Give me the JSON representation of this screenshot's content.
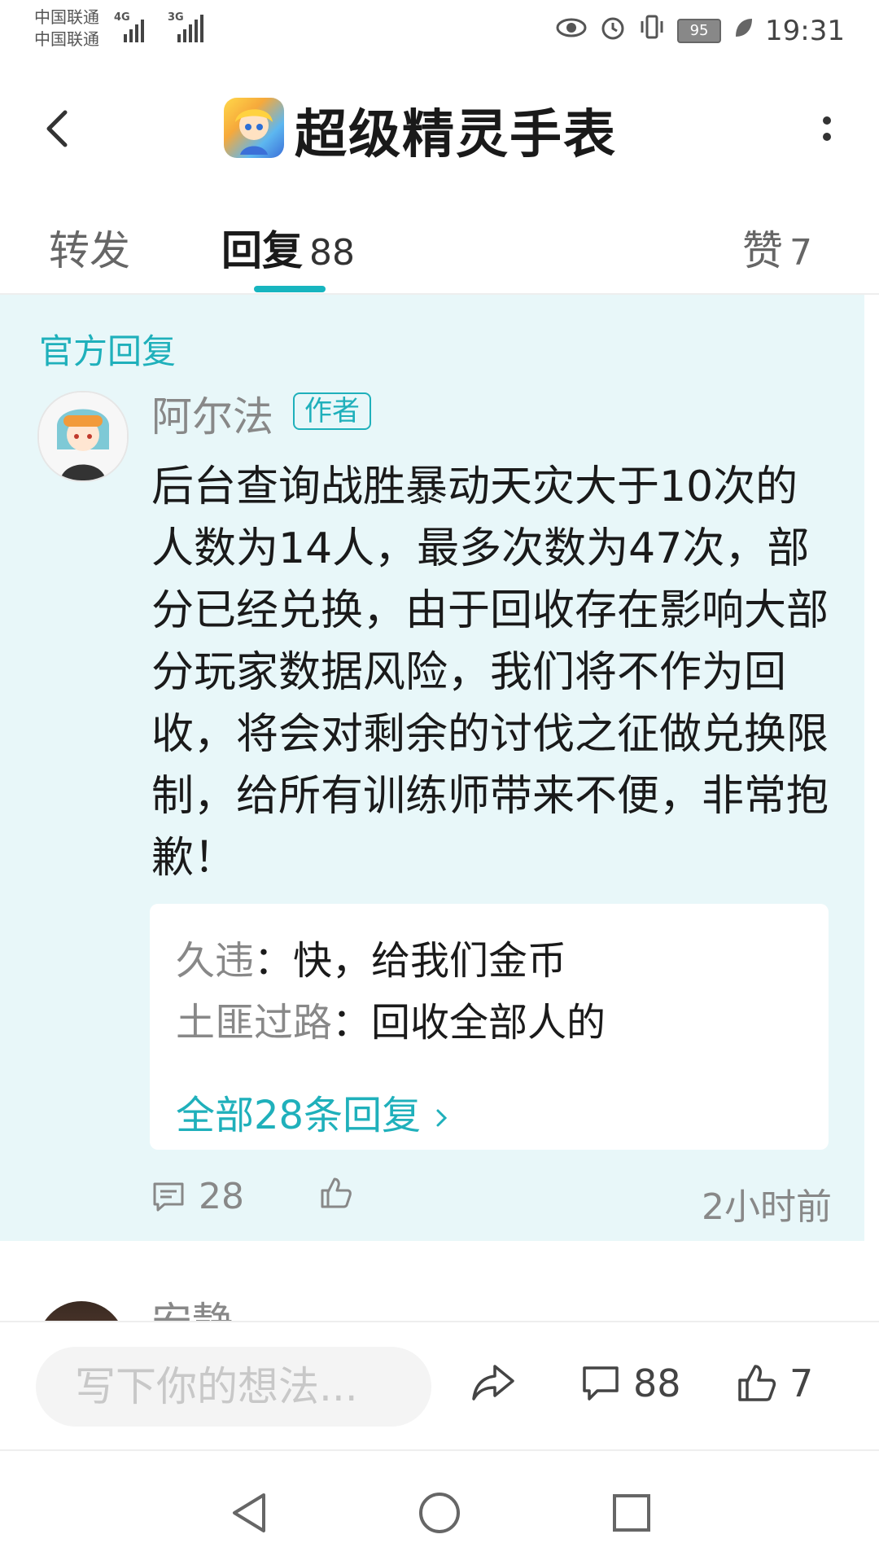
{
  "status_bar": {
    "carrier1": "中国联通",
    "carrier2": "中国联通",
    "net1": "4G",
    "net2": "3G",
    "battery": "95",
    "time": "19:31"
  },
  "header": {
    "title": "超级精灵手表"
  },
  "tabs": [
    {
      "label": "转发"
    },
    {
      "label": "回复",
      "count": "88"
    },
    {
      "label": "赞",
      "count": "7"
    }
  ],
  "official": {
    "section_label": "官方回复",
    "username": "阿尔法",
    "badge": "作者",
    "text": "后台查询战胜暴动天灾大于10次的人数为14人，最多次数为47次，部分已经兑换，由于回收存在影响大部分玩家数据风险，我们将不作为回收，将会对剩余的讨伐之征做兑换限制，给所有训练师带来不便，非常抱歉！",
    "sub_replies": [
      {
        "name": "久违",
        "sep": "：",
        "text": "快，给我们金币"
      },
      {
        "name": "土匪过路",
        "sep": "：",
        "text": "回收全部人的"
      }
    ],
    "all_replies_link": "全部28条回复",
    "comment_count": "28",
    "time_ago": "2小时前"
  },
  "next_comment": {
    "name": "安静"
  },
  "bottom_bar": {
    "input_placeholder": "写下你的想法...",
    "comment_count": "88",
    "like_count": "7"
  },
  "colors": {
    "accent": "#1fb0bb",
    "official_bg": "#e8f7f9"
  }
}
